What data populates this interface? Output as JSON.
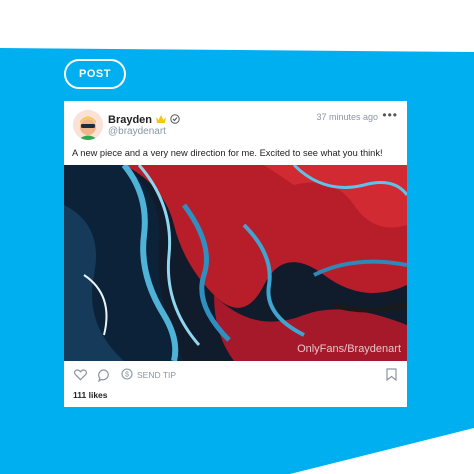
{
  "background": {
    "primary": "#00aff0",
    "panel": "#ffffff"
  },
  "post_button": {
    "label": "POST"
  },
  "post": {
    "author": "Brayden",
    "handle": "@braydenart",
    "time": "37 minutes ago",
    "caption": "A new piece and a very new direction for me.  Excited to see what you think!",
    "watermark": "OnlyFans/Braydenart",
    "send_tip_label": "SEND TIP",
    "likes": "111 likes",
    "more_label": "•••"
  },
  "icons": [
    "crown-emoji-icon",
    "verified-icon",
    "heart-icon",
    "comment-icon",
    "dollar-icon",
    "bookmark-icon"
  ]
}
